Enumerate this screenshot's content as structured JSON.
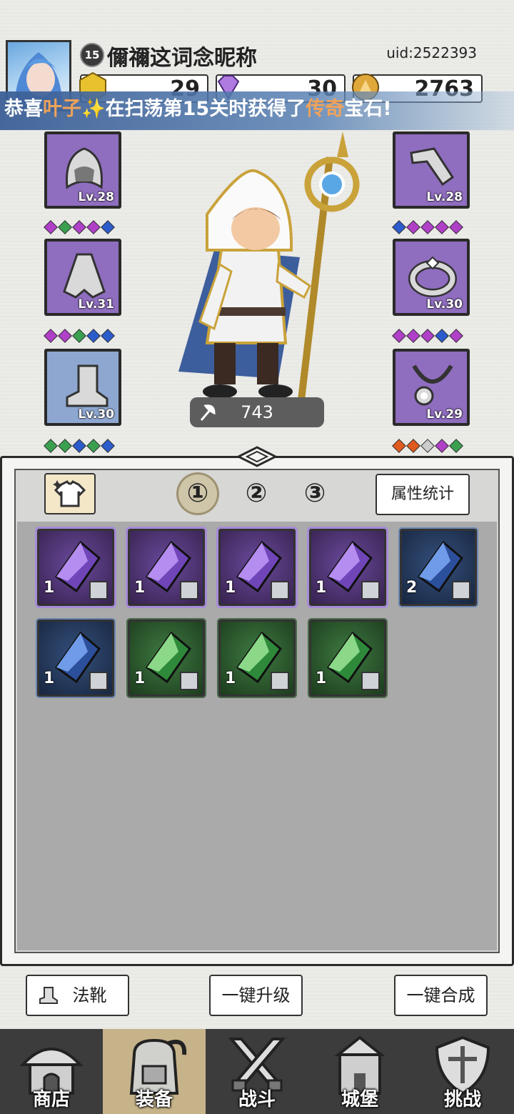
{
  "header": {
    "level": "15",
    "nickname": "儞禰这词念昵称",
    "uid": "uid:2522393",
    "currency": [
      {
        "name": "gold-hex",
        "value": "29",
        "color": "#e8c22e"
      },
      {
        "name": "diamond",
        "value": "30",
        "color": "#b07be0"
      },
      {
        "name": "coin",
        "value": "2763",
        "color": "#e0a83a"
      }
    ]
  },
  "banner": {
    "prefix": "恭喜",
    "player": "叶子✨",
    "middle": "在扫荡第15关时获得了",
    "rarity": "传奇",
    "suffix": "宝石!"
  },
  "equipment": {
    "left": [
      {
        "item": "hood",
        "level": "Lv.28",
        "gems": [
          "#b040c8",
          "#3aa050",
          "#b040c8",
          "#b040c8",
          "#2c5ccc"
        ]
      },
      {
        "item": "cloak",
        "level": "Lv.31",
        "gems": [
          "#b040c8",
          "#b040c8",
          "#3aa050",
          "#2c5ccc",
          "#2c5ccc"
        ]
      },
      {
        "item": "boots",
        "level": "Lv.30",
        "gems": [
          "#3aa050",
          "#3aa050",
          "#2c5ccc",
          "#3aa050",
          "#2c5ccc"
        ]
      }
    ],
    "right": [
      {
        "item": "bracer",
        "level": "Lv.28",
        "gems": [
          "#2c5ccc",
          "#b040c8",
          "#b040c8",
          "#b040c8",
          "#b040c8"
        ]
      },
      {
        "item": "ring",
        "level": "Lv.30",
        "gems": [
          "#b040c8",
          "#b040c8",
          "#b040c8",
          "#2c5ccc",
          "#b040c8"
        ]
      },
      {
        "item": "necklace",
        "level": "Lv.29",
        "gems": [
          "#e05a20",
          "#e05a20",
          "#cccccc",
          "#b040c8",
          "#3aa050"
        ]
      }
    ]
  },
  "hero": {
    "power": "743"
  },
  "panel": {
    "pages": [
      "①",
      "②",
      "③"
    ],
    "stats_button": "属性统计",
    "gems": [
      {
        "color": "purple",
        "count": "1"
      },
      {
        "color": "purple",
        "count": "1"
      },
      {
        "color": "purple",
        "count": "1"
      },
      {
        "color": "purple",
        "count": "1"
      },
      {
        "color": "blue",
        "count": "2"
      },
      {
        "color": "blue",
        "count": "1"
      },
      {
        "color": "green",
        "count": "1"
      },
      {
        "color": "green",
        "count": "1"
      },
      {
        "color": "green",
        "count": "1"
      }
    ]
  },
  "actions": {
    "category": "法靴",
    "upgrade_all": "一键升级",
    "merge_all": "一键合成"
  },
  "nav": [
    {
      "label": "商店",
      "icon": "shop-icon"
    },
    {
      "label": "装备",
      "icon": "backpack-icon"
    },
    {
      "label": "战斗",
      "icon": "swords-icon"
    },
    {
      "label": "城堡",
      "icon": "castle-icon"
    },
    {
      "label": "挑战",
      "icon": "shield-icon"
    }
  ]
}
